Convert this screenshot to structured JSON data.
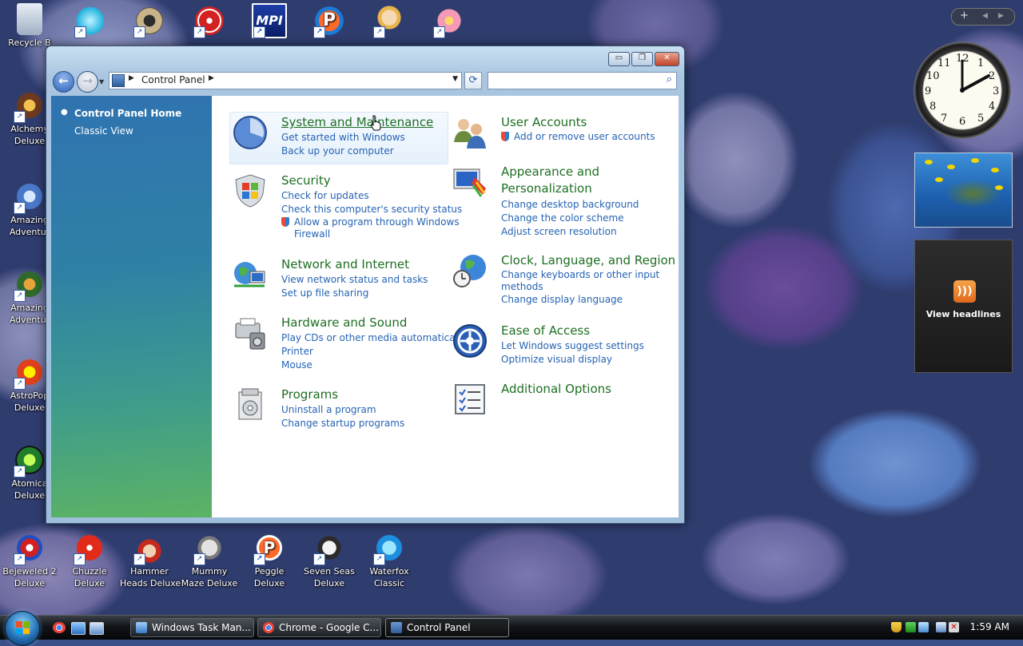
{
  "desktop": {
    "top_icons": [
      {
        "label": "Recycle B",
        "icon": "recycle-bin-icon"
      },
      {
        "label": "",
        "icon": "diamond-icon"
      },
      {
        "label": "",
        "icon": "gear-icon"
      },
      {
        "label": "",
        "icon": "radiation-icon"
      },
      {
        "label": "",
        "icon": "mpi-icon"
      },
      {
        "label": "",
        "icon": "p-logo-icon"
      },
      {
        "label": "",
        "icon": "fairy-icon"
      },
      {
        "label": "",
        "icon": "flower-icon"
      }
    ],
    "left_icons": [
      {
        "label1": "Alchemy",
        "label2": "Deluxe"
      },
      {
        "label1": "Amazing",
        "label2": "Adventur"
      },
      {
        "label1": "Amazing",
        "label2": "Adventur"
      },
      {
        "label1": "AstroPop",
        "label2": "Deluxe"
      },
      {
        "label1": "Atomica",
        "label2": "Deluxe"
      }
    ],
    "bottom_icons": [
      {
        "label1": "Bejeweled 2",
        "label2": "Deluxe"
      },
      {
        "label1": "Chuzzle",
        "label2": "Deluxe"
      },
      {
        "label1": "Hammer",
        "label2": "Heads Deluxe"
      },
      {
        "label1": "Mummy",
        "label2": "Maze Deluxe"
      },
      {
        "label1": "Peggle",
        "label2": "Deluxe"
      },
      {
        "label1": "Seven Seas",
        "label2": "Deluxe"
      },
      {
        "label1": "Waterfox",
        "label2": "Classic"
      }
    ]
  },
  "window": {
    "title_buttons": {
      "minimize": "▭",
      "maximize": "❐",
      "close": "✕"
    },
    "address": {
      "path": "Control Panel",
      "dropdown": "▼",
      "sep": "▶"
    },
    "search": {
      "placeholder": "",
      "value": ""
    },
    "sidebar": {
      "home": "Control Panel Home",
      "classic": "Classic View"
    },
    "categories": {
      "system": {
        "title": "System and Maintenance",
        "links": [
          "Get started with Windows",
          "Back up your computer"
        ]
      },
      "security": {
        "title": "Security",
        "links": [
          "Check for updates",
          "Check this computer's security status"
        ],
        "shield_link1": "Allow a program through Windows",
        "shield_link2": "Firewall"
      },
      "network": {
        "title": "Network and Internet",
        "links": [
          "View network status and tasks",
          "Set up file sharing"
        ]
      },
      "hardware": {
        "title": "Hardware and Sound",
        "links": [
          "Play CDs or other media automatically",
          "Printer",
          "Mouse"
        ]
      },
      "programs": {
        "title": "Programs",
        "links": [
          "Uninstall a program",
          "Change startup programs"
        ]
      },
      "users": {
        "title": "User Accounts",
        "shield_link1": "Add or remove user accounts"
      },
      "appearance": {
        "title1": "Appearance and",
        "title2": "Personalization",
        "links": [
          "Change desktop background",
          "Change the color scheme",
          "Adjust screen resolution"
        ]
      },
      "clock": {
        "title": "Clock, Language, and Region",
        "links": [
          "Change keyboards or other input",
          "methods",
          "Change display language"
        ]
      },
      "ease": {
        "title": "Ease of Access",
        "links": [
          "Let Windows suggest settings",
          "Optimize visual display"
        ]
      },
      "additional": {
        "title": "Additional Options"
      }
    }
  },
  "gadgets": {
    "bar_plus": "+",
    "clock_numbers": [
      "12",
      "1",
      "2",
      "3",
      "4",
      "5",
      "6",
      "7",
      "8",
      "9",
      "10",
      "11"
    ],
    "feed_text": "View headlines",
    "feed_icon": "rss-icon"
  },
  "taskbar": {
    "tasks": [
      "Windows Task Man...",
      "Chrome - Google C...",
      "Control Panel"
    ],
    "time": "1:59 AM"
  },
  "colors": {
    "category_title": "#1e6f22",
    "link": "#2563b4"
  }
}
